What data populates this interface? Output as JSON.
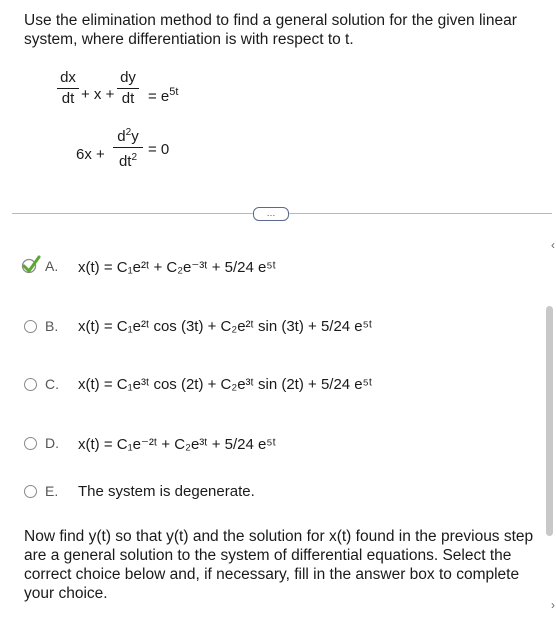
{
  "question": {
    "prompt": "Use the elimination method to find a general solution for the given linear system, where differentiation is with respect to t."
  },
  "system": {
    "eq1": {
      "frac1_num": "dx",
      "frac1_den": "dt",
      "middle": "+ x +",
      "frac2_num": "dy",
      "frac2_den": "dt",
      "rhs": "= e",
      "rhs_sup": "5t"
    },
    "eq2": {
      "left": "6x +",
      "frac_num": "d",
      "frac_num_sup": "2",
      "frac_num_tail": "y",
      "frac_den": "dt",
      "frac_den_sup": "2",
      "rhs": "= 0"
    }
  },
  "ellipsis": "…",
  "options": [
    {
      "letter": "A.",
      "selected": true,
      "text": "x(t) = C₁e²ᵗ + C₂e⁻³ᵗ + 5/24 e⁵ᵗ"
    },
    {
      "letter": "B.",
      "selected": false,
      "text": "x(t) = C₁e²ᵗ cos (3t) + C₂e²ᵗ sin (3t) + 5/24 e⁵ᵗ"
    },
    {
      "letter": "C.",
      "selected": false,
      "text": "x(t) = C₁e³ᵗ cos (2t) + C₂e³ᵗ sin (2t) + 5/24 e⁵ᵗ"
    },
    {
      "letter": "D.",
      "selected": false,
      "text": "x(t) = C₁e⁻²ᵗ + C₂e³ᵗ + 5/24 e⁵ᵗ"
    },
    {
      "letter": "E.",
      "selected": false,
      "text": "The system is degenerate."
    }
  ],
  "followup": "Now find y(t) so that y(t) and the solution for x(t) found in the previous step are a general solution to the system of differential equations. Select the correct choice below and, if necessary, fill in the answer box to complete your choice.",
  "colors": {
    "check": "#5aa832",
    "radio_border": "#8a8a8a",
    "text": "#1a1a1a"
  }
}
